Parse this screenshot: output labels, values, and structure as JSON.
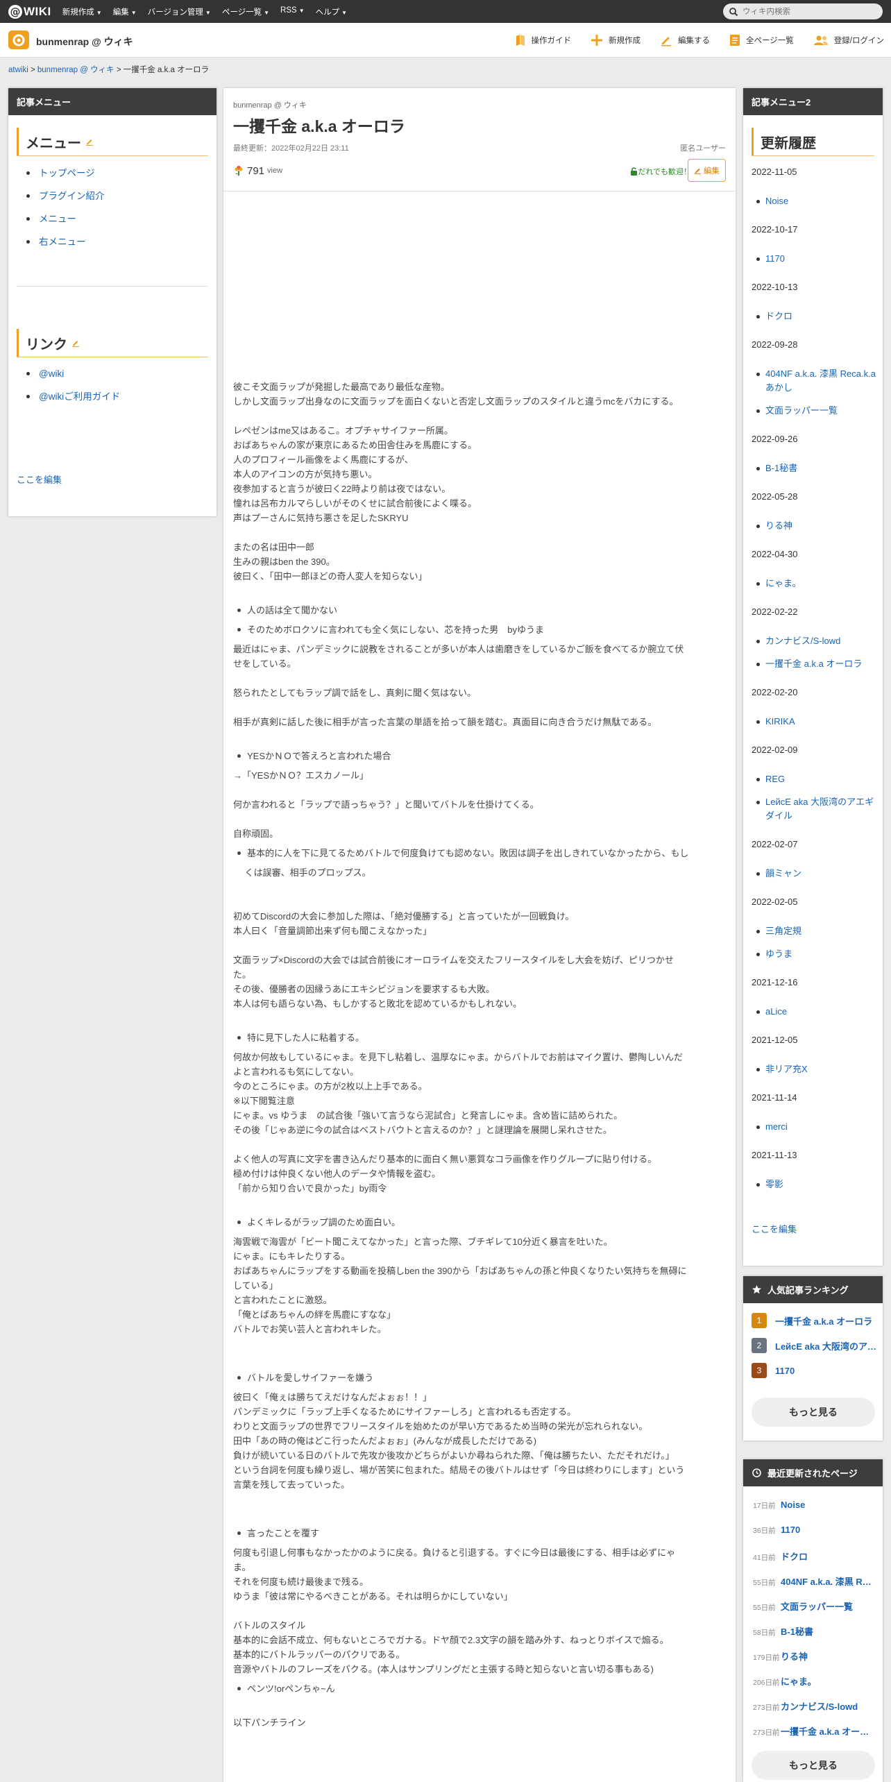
{
  "topbar": {
    "logo_text": "WIKI",
    "nav": [
      "新規作成",
      "編集",
      "バージョン管理",
      "ページ一覧",
      "RSS",
      "ヘルプ"
    ],
    "search_placeholder": "ウィキ内検索"
  },
  "header": {
    "site_title": "bunmenrap @ ウィキ",
    "tools": [
      "操作ガイド",
      "新規作成",
      "編集する",
      "全ページ一覧",
      "登録/ログイン"
    ]
  },
  "breadcrumb": {
    "root": "atwiki",
    "sep": ">",
    "site": "bunmenrap @ ウィキ",
    "current": "一攫千金 a.k.a オーロラ"
  },
  "left_sidebar": {
    "title": "記事メニュー",
    "menu_title": "メニュー",
    "menu_items": [
      "トップページ",
      "プラグイン紹介",
      "メニュー",
      "右メニュー"
    ],
    "links_title": "リンク",
    "link_items": [
      "@wiki",
      "@wikiご利用ガイド"
    ],
    "edit_link": "ここを編集"
  },
  "article": {
    "site": "bunmenrap @ ウィキ",
    "title": "一攫千金 a.k.a オーロラ",
    "updated": "最終更新：2022年02月22日 23:11",
    "user": "匿名ユーザー",
    "views": "791",
    "views_label": "view",
    "welcome": "だれでも歓迎！",
    "edit_label": "編集",
    "lines": [
      "彼こそ文面ラップが発掘した最高であり最低な産物。",
      "しかし文面ラップ出身なのに文面ラップを面白くないと否定し文面ラップのスタイルと違うmcをバカにする。",
      "",
      "レペゼンはme又はあるこ。オプチャサイファー所属。",
      "おばあちゃんの家が東京にあるため田舎住みを馬鹿にする。",
      "人のプロフィール画像をよく馬鹿にするが、",
      "本人のアイコンの方が気持ち悪い。",
      "夜参加すると言うが彼曰く22時より前は夜ではない。",
      "憧れは呂布カルマらしいがそのくせに試合前後によく喋る。",
      "声はプーさんに気持ち悪さを足したSKRYU",
      "",
      "またの名は田中一郎",
      "生みの親はben the 390。",
      "彼曰く、「田中一郎ほどの奇人変人を知らない」",
      "",
      "• 人の話は全て聞かない",
      "• そのためボロクソに言われても全く気にしない、芯を持った男　byゆうま",
      "最近はにゃま、パンデミックに説教をされることが多いが本人は歯磨きをしているかご飯を食べてるか腕立て伏",
      "せをしている。",
      "",
      "怒られたとしてもラップ調で話をし、真剣に聞く気はない。",
      "",
      "相手が真剣に話した後に相手が言った言葉の単語を拾って韻を踏む。真面目に向き合うだけ無駄である。",
      "",
      "• YESかＮＯで答えろと言われた場合",
      "→「YESかＮＯ？エスカノール」",
      "",
      "何か言われると「ラップで語っちゃう？」と聞いてバトルを仕掛けてくる。",
      "",
      "自称頑固。",
      "• 基本的に人を下に見てるためバトルで何度負けても認めない。敗因は調子を出しきれていなかったから、もし",
      "　 くは誤審、相手のプロップス。",
      "",
      "",
      "初めてDiscordの大会に参加した際は、「絶対優勝する」と言っていたが一回戦負け。",
      "本人曰く「音量調節出来ず何も聞こえなかった」",
      "",
      "文面ラップ×Discordの大会では試合前後にオーロライムを交えたフリースタイルをし大会を妨げ、ピリつかせ",
      "た。",
      "その後、優勝者の因縁うあにエキシビジョンを要求するも大敗。",
      "本人は何も語らない為、もしかすると敗北を認めているかもしれない。",
      "",
      "• 特に見下した人に粘着する。",
      "何故か何故もしているにゃま。を見下し粘着し、温厚なにゃま。からバトルでお前はマイク置け、鬱陶しいんだ",
      "よと言われるも気にしてない。",
      "今のところにゃま。の方が2枚以上上手である。",
      "※以下閲覧注意",
      "にゃま。vs ゆうま　の試合後「強いて言うなら泥試合」と発言しにゃま。含め皆に詰められた。",
      "その後「じゃあ逆に今の試合はベストバウトと言えるのか？」と謎理論を展開し呆れさせた。",
      "",
      "よく他人の写真に文字を書き込んだり基本的に面白く無い悪質なコラ画像を作りグループに貼り付ける。",
      "極め付けは仲良くない他人のデータや情報を盗む。",
      "「前から知り合いで良かった」by雨令",
      "",
      "• よくキレるがラップ調のため面白い。",
      "海雲戦で海雲が「ビート聞こえてなかった」と言った際、ブチギレて10分近く暴言を吐いた。",
      "にゃま。にもキレたりする。",
      "おばあちゃんにラップをする動画を投稿しben the 390から「おばあちゃんの孫と仲良くなりたい気持ちを無碍に",
      "している」",
      "と言われたことに激怒。",
      "「俺とばあちゃんの絆を馬鹿にすなな」",
      "バトルでお笑い芸人と言われキレた。",
      "",
      "",
      "• バトルを愛しサイファーを嫌う",
      "彼曰く「俺ぇは勝ちてえだけなんだよぉぉ！！」",
      "パンデミックに「ラップ上手くなるためにサイファーしろ」と言われるも否定する。",
      "わりと文面ラップの世界でフリースタイルを始めたのが早い方であるため当時の栄光が忘れられない。",
      "田中「あの時の俺はどこ行ったんだよぉぉ」(みんなが成長しただけである)",
      "負けが続いている日のバトルで先攻か後攻かどちらがよいか尋ねられた際、「俺は勝ちたい、ただそれだけ。」",
      "という台詞を何度も繰り返し、場が苦笑に包まれた。結局その後バトルはせず「今日は終わりにします」という",
      "言葉を残して去っていった。",
      "",
      "",
      "• 言ったことを覆す",
      "何度も引退し何事もなかったかのように戻る。負けると引退する。すぐに今日は最後にする、相手は必ずにゃ",
      "ま。",
      "それを何度も続け最後まで残る。",
      "ゆうま「彼は常にやるべきことがある。それは明らかにしていない」",
      "",
      "バトルのスタイル",
      "基本的に会話不成立、何もないところでガナる。ドヤ顔で2.3文字の韻を踏み外す、ねっとりボイスで煽る。",
      "基本的にバトルラッパーのパクリである。",
      "音源やバトルのフレーズをパクる。(本人はサンプリングだと主張する時と知らないと言い切る事もある)",
      "• ペンツ!orペンちゃ~ん",
      "",
      "以下パンチライン"
    ]
  },
  "right_sidebar": {
    "title": "記事メニュー2",
    "history_title": "更新履歴",
    "history": [
      {
        "date": "2022-11-05",
        "items": [
          "Noise"
        ]
      },
      {
        "date": "2022-10-17",
        "items": [
          "1170"
        ]
      },
      {
        "date": "2022-10-13",
        "items": [
          "ドクロ"
        ]
      },
      {
        "date": "2022-09-28",
        "items": [
          "404NF a.k.a. 漆黒 Reca.k.aあかし",
          "文面ラッパー一覧"
        ]
      },
      {
        "date": "2022-09-26",
        "items": [
          "B-1秘書"
        ]
      },
      {
        "date": "2022-05-28",
        "items": [
          "りる神"
        ]
      },
      {
        "date": "2022-04-30",
        "items": [
          "にゃま。"
        ]
      },
      {
        "date": "2022-02-22",
        "items": [
          "カンナビス/S-lowd",
          "一攫千金 a.k.a オーロラ"
        ]
      },
      {
        "date": "2022-02-20",
        "items": [
          "KIRIKA"
        ]
      },
      {
        "date": "2022-02-09",
        "items": [
          "REG",
          "LeйcE aka 大阪湾のアエギダイル"
        ]
      },
      {
        "date": "2022-02-07",
        "items": [
          "韻ミャン"
        ]
      },
      {
        "date": "2022-02-05",
        "items": [
          "三角定規",
          "ゆうま"
        ]
      },
      {
        "date": "2021-12-16",
        "items": [
          "aLice"
        ]
      },
      {
        "date": "2021-12-05",
        "items": [
          "非リア充X"
        ]
      },
      {
        "date": "2021-11-14",
        "items": [
          "merci"
        ]
      },
      {
        "date": "2021-11-13",
        "items": [
          "零影"
        ]
      }
    ],
    "edit_link": "ここを編集"
  },
  "ranking": {
    "title": "人気記事ランキング",
    "items": [
      {
        "rank": "1",
        "name": "一攫千金 a.k.a オーロラ",
        "color": "#d4880f"
      },
      {
        "rank": "2",
        "name": "LeйcE aka 大阪湾のアエギダイル",
        "color": "#6b7280"
      },
      {
        "rank": "3",
        "name": "1170",
        "color": "#9a4a1a"
      }
    ],
    "more": "もっと見る"
  },
  "recent": {
    "title": "最近更新されたページ",
    "items": [
      {
        "ago": "17日前",
        "name": "Noise"
      },
      {
        "ago": "36日前",
        "name": "1170"
      },
      {
        "ago": "41日前",
        "name": "ドクロ"
      },
      {
        "ago": "55日前",
        "name": "404NF a.k.a. 漆黒 Reca.k.aあかし"
      },
      {
        "ago": "55日前",
        "name": "文面ラッパー一覧"
      },
      {
        "ago": "58日前",
        "name": "B-1秘書"
      },
      {
        "ago": "179日前",
        "name": "りる神"
      },
      {
        "ago": "206日前",
        "name": "にゃま。"
      },
      {
        "ago": "273日前",
        "name": "カンナビス/S-lowd"
      },
      {
        "ago": "273日前",
        "name": "一攫千金 a.k.a オーロラ"
      }
    ],
    "more": "もっと見る"
  },
  "colors": {
    "accent": "#f0a020",
    "link": "#1a64b4",
    "dark": "#333333"
  }
}
